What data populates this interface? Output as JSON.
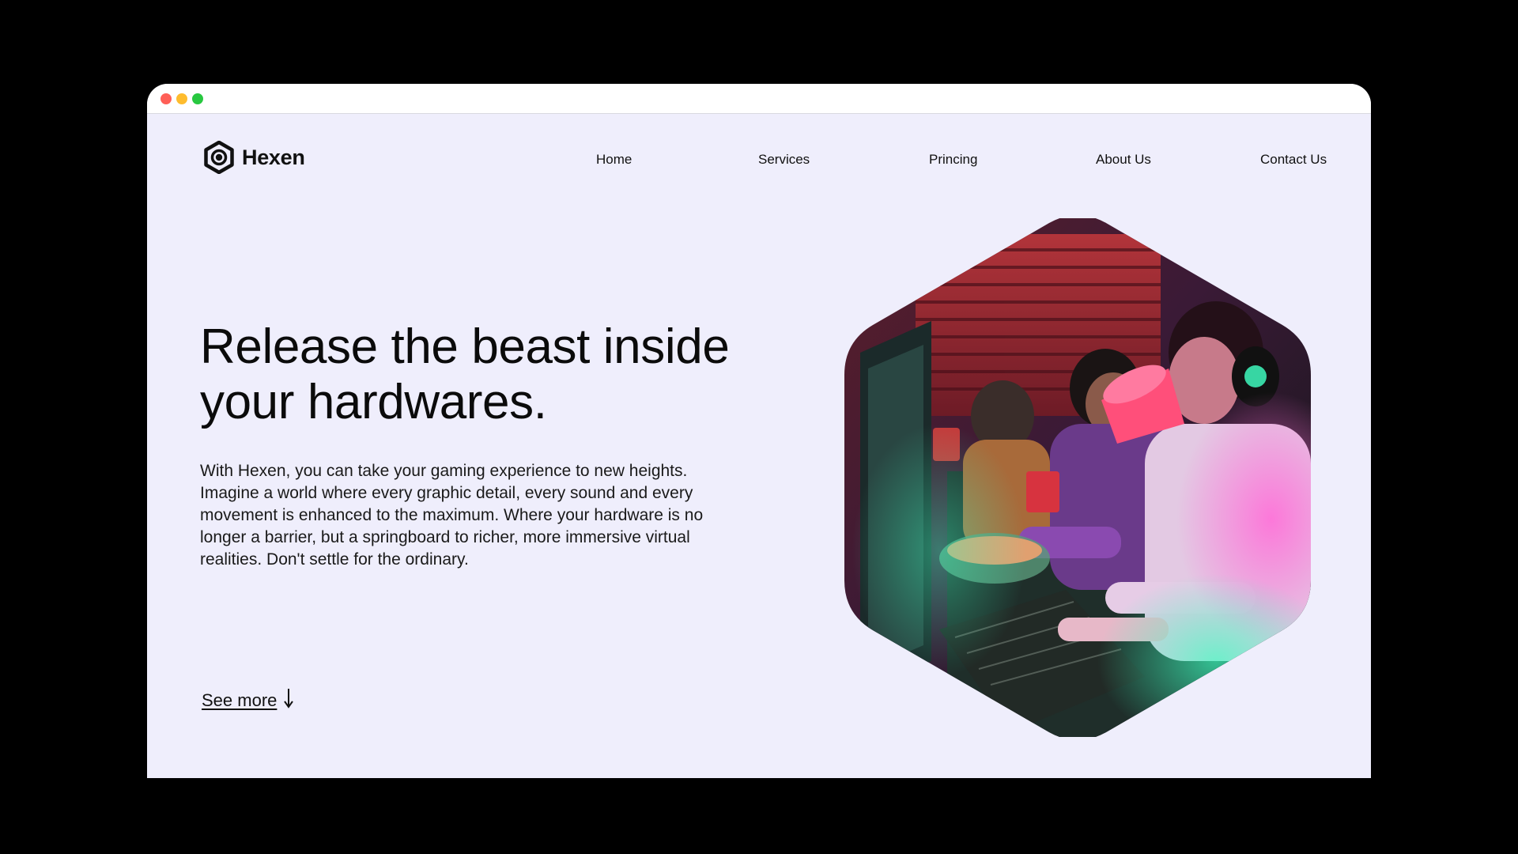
{
  "window": {
    "controls": [
      {
        "name": "close",
        "color": "#ff5f57"
      },
      {
        "name": "minimize",
        "color": "#febc2e"
      },
      {
        "name": "maximize",
        "color": "#28c840"
      }
    ]
  },
  "brand": {
    "name": "Hexen",
    "icon": "hexagon-nut-logo-icon"
  },
  "nav": {
    "items": [
      {
        "label": "Home"
      },
      {
        "label": "Services"
      },
      {
        "label": "Princing"
      },
      {
        "label": "About Us"
      },
      {
        "label": "Contact Us"
      }
    ]
  },
  "hero": {
    "headline": "Release the beast inside your hardwares.",
    "body": "With Hexen, you can take your gaming experience to new heights. Imagine a world where every graphic detail, every sound and every movement is enhanced to the maximum. Where your hardware is no longer a barrier, but a springboard to richer, more immersive virtual realities. Don't settle for the ordinary.",
    "cta": {
      "label": "See more",
      "icon": "arrow-down-icon"
    },
    "image": {
      "shape": "hexagon",
      "subject": "gamers-at-computers-photo"
    }
  },
  "colors": {
    "page_background": "#efeefc",
    "outer_background": "#000000",
    "text": "#111111"
  }
}
